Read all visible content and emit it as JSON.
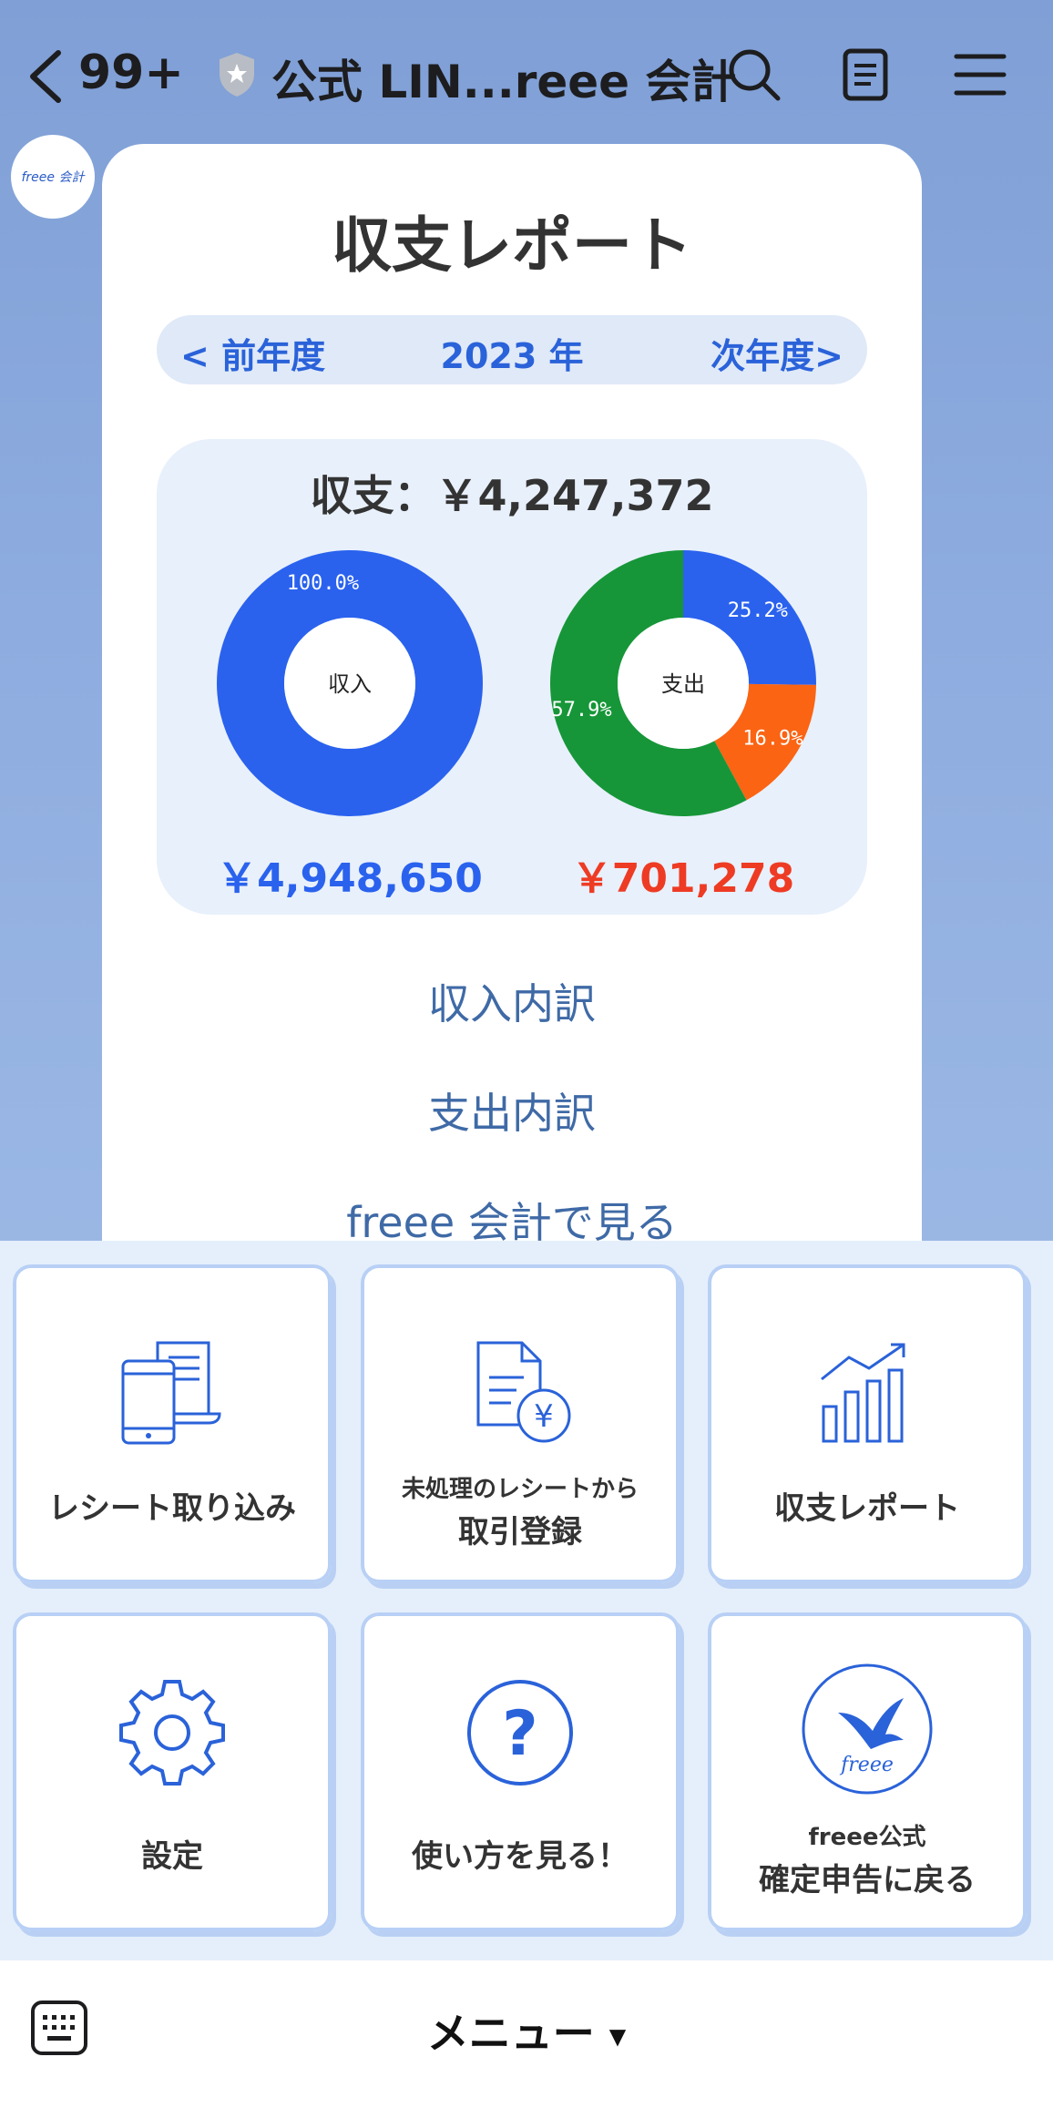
{
  "header": {
    "back_count": "99+",
    "title": "公式 LIN...reee 会計"
  },
  "avatar": {
    "logo_text": "freee 会計"
  },
  "report": {
    "title": "収支レポート",
    "year_nav": {
      "prev_label": "< 前年度",
      "current_year": "2023 年",
      "next_label": "次年度>"
    },
    "balance_text": "収支：￥4,247,372",
    "income": {
      "label": "収入",
      "amount": "￥4,948,650",
      "color": "#2a62ee",
      "slices": [
        {
          "percent_label": "100.0%",
          "value": 100.0,
          "color": "#2a62ee"
        }
      ]
    },
    "expense": {
      "label": "支出",
      "amount": "￥701,278",
      "color": "#ee3b24",
      "slices": [
        {
          "percent_label": "25.2%",
          "value": 25.2,
          "color": "#2a62ee"
        },
        {
          "percent_label": "16.9%",
          "value": 16.9,
          "color": "#fb6413"
        },
        {
          "percent_label": "57.9%",
          "value": 57.9,
          "color": "#169638"
        }
      ]
    },
    "links": [
      "収入内訳",
      "支出内訳",
      "freee 会計で見る"
    ]
  },
  "rich_menu": {
    "tiles": [
      {
        "sub": "",
        "label": "レシート取り込み",
        "icon": "receipt-phone-icon"
      },
      {
        "sub": "未処理のレシートから",
        "label": "取引登録",
        "icon": "yen-document-icon"
      },
      {
        "sub": "",
        "label": "収支レポート",
        "icon": "growth-chart-icon"
      },
      {
        "sub": "",
        "label": "設定",
        "icon": "gear-icon"
      },
      {
        "sub": "",
        "label": "使い方を見る！",
        "icon": "question-icon"
      },
      {
        "sub": "freee公式",
        "label": "確定申告に戻る",
        "icon": "freee-bird-icon"
      }
    ]
  },
  "bottom_bar": {
    "menu_label": "メニュー"
  },
  "colors": {
    "accent": "#2a62d9",
    "link": "#3f6aa6",
    "tile_border": "#b8d0f5"
  }
}
